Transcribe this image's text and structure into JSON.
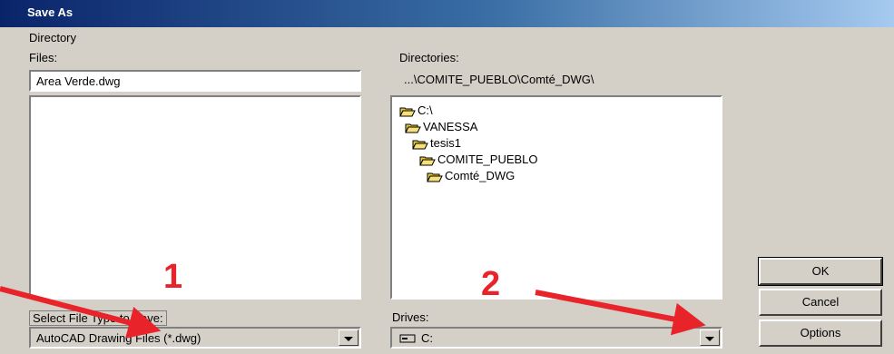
{
  "window": {
    "title": "Save As"
  },
  "menu": {
    "directory_label": "Directory"
  },
  "files": {
    "label": "Files:",
    "value": "Area Verde.dwg"
  },
  "directories": {
    "label": "Directories:",
    "path": "...\\COMITE_PUEBLO\\Comté_DWG\\",
    "tree": [
      {
        "label": "C:\\"
      },
      {
        "label": "VANESSA"
      },
      {
        "label": "tesis1"
      },
      {
        "label": "COMITE_PUEBLO"
      },
      {
        "label": "Comté_DWG"
      }
    ]
  },
  "file_type": {
    "label": "Select File Type to Save:",
    "selected": "AutoCAD Drawing Files (*.dwg)"
  },
  "drives": {
    "label": "Drives:",
    "selected": "C:"
  },
  "buttons": {
    "ok": "OK",
    "cancel": "Cancel",
    "options": "Options"
  },
  "annotations": {
    "marker1": "1",
    "marker2": "2",
    "arrow_color": "#e8242a"
  },
  "colors": {
    "titlebar_start": "#0a246a",
    "titlebar_end": "#a6caf0",
    "face": "#d4d0c8"
  },
  "icons": {
    "folder": "folder-open-icon",
    "drive": "drive-icon"
  }
}
